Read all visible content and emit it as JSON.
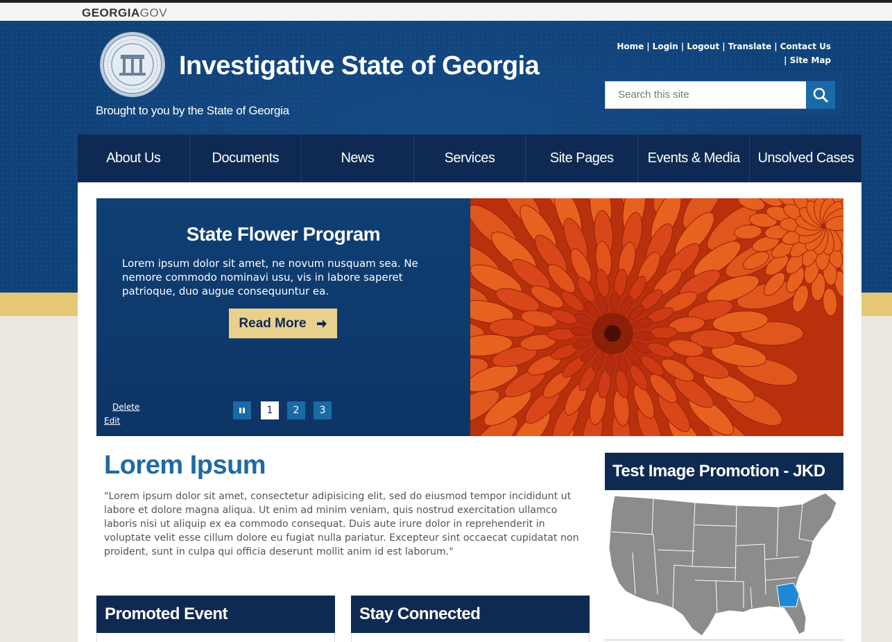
{
  "topbar": {
    "logo_bold": "GEORGIA",
    "logo_light": "GOV"
  },
  "header": {
    "seal_name": "georgia-state-seal",
    "title": "Investigative State of Georgia",
    "tagline": "Brought to you by the State of Georgia",
    "links": [
      "Home",
      "Login",
      "Logout",
      "Translate",
      "Contact Us",
      "Site Map"
    ],
    "search_placeholder": "Search this site",
    "search_icon": "search-icon"
  },
  "nav": {
    "items": [
      "About Us",
      "Documents",
      "News",
      "Services",
      "Site Pages",
      "Events & Media",
      "Unsolved Cases"
    ]
  },
  "slider": {
    "title": "State Flower Program",
    "body": "Lorem ipsum dolor sit amet, ne novum nusquam sea. Ne nemore commodo nominavi usu, vis in labore saperet patrioque, duo augue consequuntur ea.",
    "button_label": "Read More",
    "button_icon": "arrow-right-icon",
    "pause_icon": "pause-icon",
    "pages": [
      "1",
      "2",
      "3"
    ],
    "current_page": 1,
    "delete_label": "Delete",
    "edit_label": "Edit"
  },
  "content": {
    "title": "Lorem Ipsum",
    "body": "\"Lorem ipsum dolor sit amet, consectetur adipisicing elit, sed do eiusmod tempor incididunt ut labore et dolore magna aliqua. Ut enim ad minim veniam, quis nostrud exercitation ullamco laboris nisi ut aliquip ex ea commodo consequat. Duis aute irure dolor in reprehenderit in voluptate velit esse cillum dolore eu fugiat nulla pariatur. Excepteur sint occaecat cupidatat non proident, sunt in culpa qui officia deserunt mollit anim id est laborum.\""
  },
  "boxes": {
    "promoted_event": "Promoted Event",
    "stay_connected": "Stay Connected"
  },
  "promotion": {
    "title": "Test Image Promotion - JKD",
    "highlight_state": "Georgia"
  },
  "colors": {
    "header_blue": "#10427a",
    "nav_dark": "#0f2a52",
    "gold": "#e6c877",
    "accent_blue": "#1a6aa8",
    "title_blue": "#1e6aa4"
  }
}
